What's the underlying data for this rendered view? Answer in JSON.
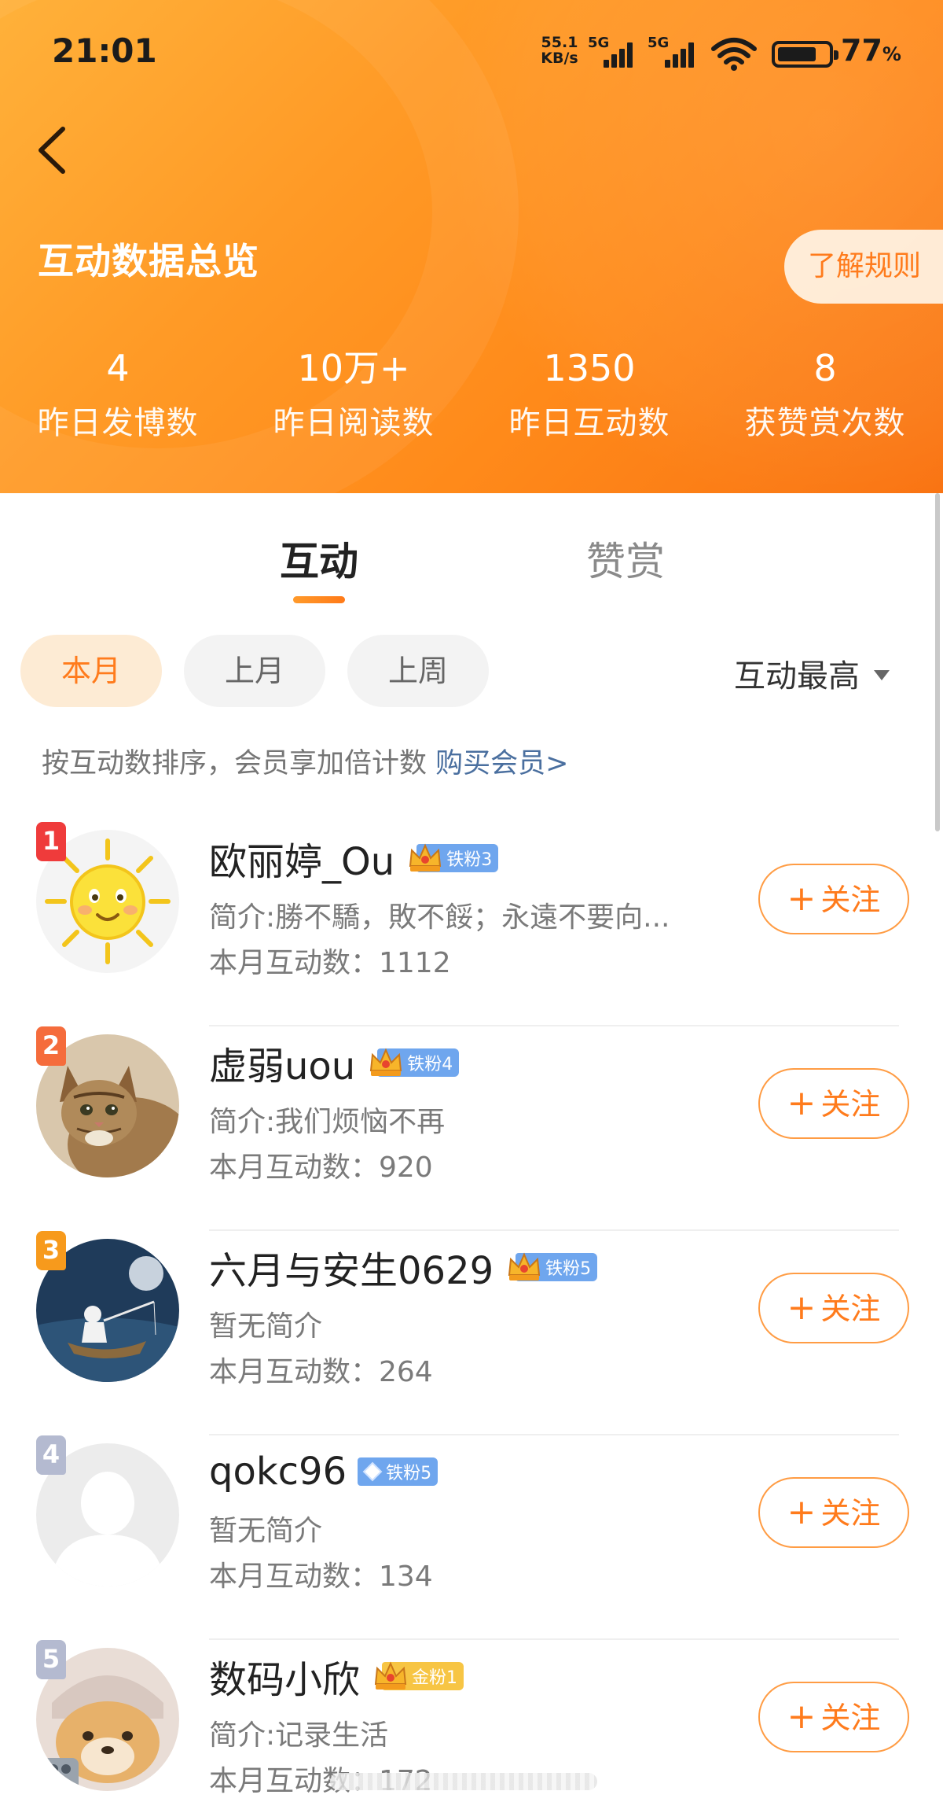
{
  "status_bar": {
    "time": "21:01",
    "net_speed_value": "55.1",
    "net_speed_unit": "KB/s",
    "signal1_label": "5G",
    "signal2_label": "5G",
    "battery_percent": "77",
    "battery_level": 0.77
  },
  "header": {
    "title": "互动数据总览",
    "rules_button": "了解规则",
    "stats": [
      {
        "value": "4",
        "label": "昨日发博数"
      },
      {
        "value": "10万+",
        "label": "昨日阅读数"
      },
      {
        "value": "1350",
        "label": "昨日互动数"
      },
      {
        "value": "8",
        "label": "获赞赏次数"
      }
    ]
  },
  "tabs": {
    "active": "互动",
    "other": "赞赏"
  },
  "filters": {
    "chips": [
      "本月",
      "上月",
      "上周"
    ],
    "sort_label": "互动最高"
  },
  "hint": {
    "text": "按互动数排序，会员享加倍计数 ",
    "link": "购买会员>"
  },
  "follow_label": "关注",
  "rankings": [
    {
      "rank": "1",
      "name": "欧丽婷_Ou",
      "badge": "铁粉3",
      "bio": "简介:勝不驕，敗不餒；永遠不要向...",
      "count": "本月互动数：1112"
    },
    {
      "rank": "2",
      "name": "虚弱uou",
      "badge": "铁粉4",
      "bio": "简介:我们烦恼不再",
      "count": "本月互动数：920"
    },
    {
      "rank": "3",
      "name": "六月与安生0629",
      "badge": "铁粉5",
      "bio": "暂无简介",
      "count": "本月互动数：264"
    },
    {
      "rank": "4",
      "name": "qokc96",
      "badge": "铁粉5",
      "bio": "暂无简介",
      "count": "本月互动数：134"
    },
    {
      "rank": "5",
      "name": "数码小欣",
      "badge": "金粉1",
      "bio": "简介:记录生活",
      "count": "本月互动数：172"
    }
  ],
  "colors": {
    "accent": "#ff7b1c",
    "header_gradient_start": "#ffb13a",
    "header_gradient_end": "#f97413",
    "rank1": "#ef3b3b",
    "rank2": "#f56c3c",
    "rank3": "#f79a1c",
    "rank_other": "#b4bad0",
    "link": "#4a6f9f"
  }
}
